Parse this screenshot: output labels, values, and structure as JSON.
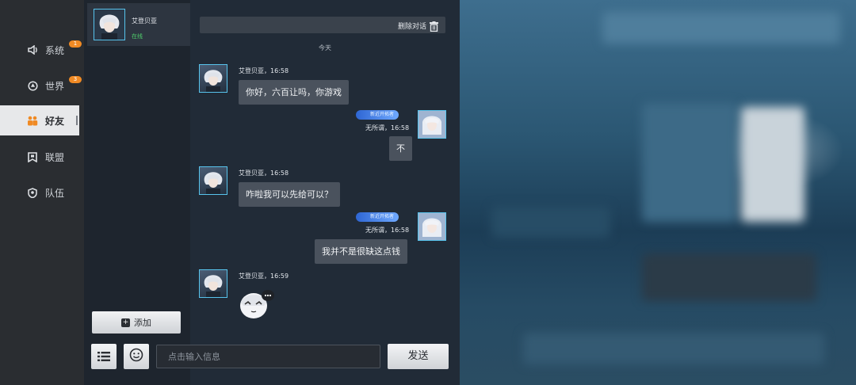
{
  "sidebar": {
    "items": [
      {
        "label": "系统",
        "icon": "speaker-icon",
        "badge": "1"
      },
      {
        "label": "世界",
        "icon": "globe-icon",
        "badge": "3"
      },
      {
        "label": "好友",
        "icon": "friends-icon",
        "active": true
      },
      {
        "label": "联盟",
        "icon": "banner-icon"
      },
      {
        "label": "队伍",
        "icon": "team-shield-icon"
      }
    ]
  },
  "friends": {
    "list": [
      {
        "name": "艾登贝亚",
        "status": "在线",
        "avatar": "white-hair-character-avatar"
      }
    ],
    "add_button": "添加"
  },
  "chat": {
    "delete_label": "删除对话",
    "date_separator": "今天",
    "messages": [
      {
        "sender": "艾登贝亚，16:58",
        "text": "你好，六百让吗，你游戏",
        "side": "left"
      },
      {
        "sender": "无所谓，16:58",
        "text": "不",
        "side": "right",
        "tag": "新近开拓者"
      },
      {
        "sender": "艾登贝亚，16:58",
        "text": "咋啦我可以先给可以？",
        "side": "left"
      },
      {
        "sender": "无所谓，16:58",
        "text": "我并不是很缺这点钱",
        "side": "right",
        "tag": "新近开拓者"
      },
      {
        "sender": "艾登贝亚，16:59",
        "side": "left",
        "sticker": "chibi-sticker"
      }
    ],
    "input_placeholder": "点击输入信息",
    "send_label": "发送"
  },
  "colors": {
    "accent_badge": "#f08a24",
    "online_green": "#4fcf6b",
    "avatar_border": "#57c3ec"
  }
}
